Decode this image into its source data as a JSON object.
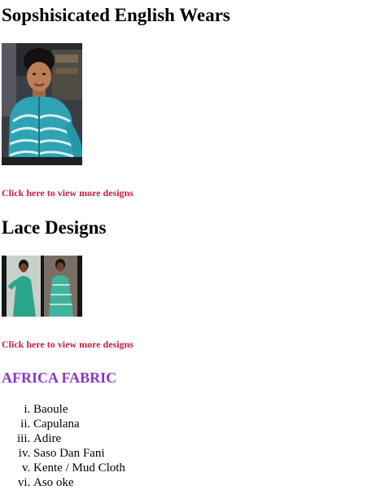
{
  "sections": [
    {
      "title": "Sopshisicated English Wears",
      "link_label": "Click here to view more designs"
    },
    {
      "title": "Lace Designs",
      "link_label": "Click here to view more designs"
    }
  ],
  "fabric_heading": "AFRICA FABRIC",
  "fabrics": [
    "Baoule",
    "Capulana",
    "Adire",
    "Saso Dan Fani",
    "Kente / Mud Cloth",
    "Aso oke"
  ],
  "colors": {
    "link": "#c2213f",
    "fabric_heading": "#8a35c9"
  }
}
